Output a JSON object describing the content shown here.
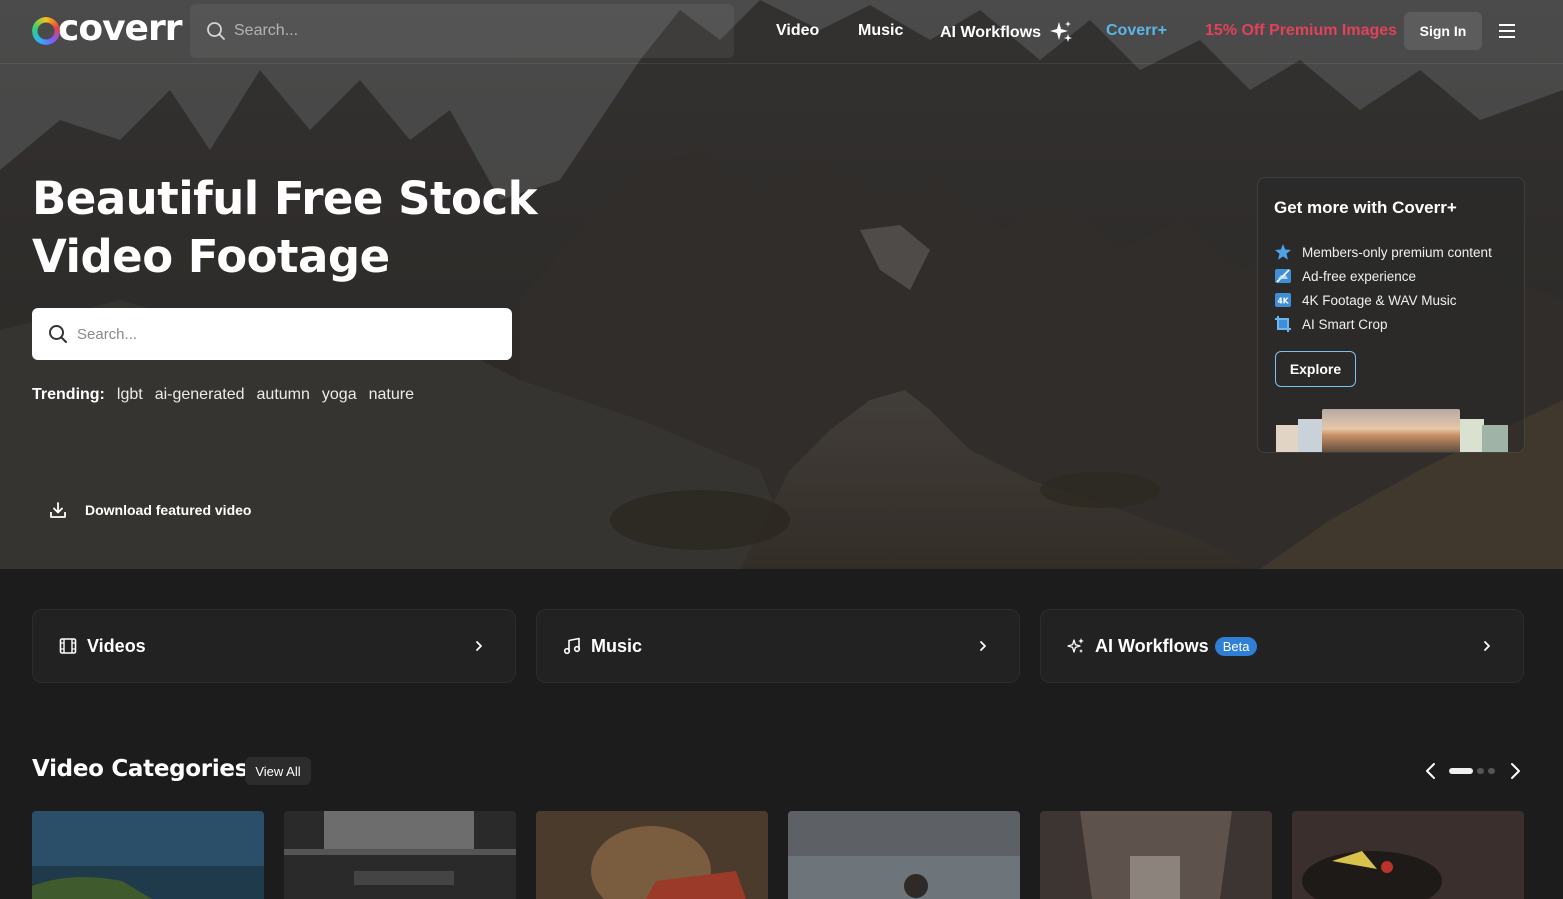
{
  "nav": {
    "logo_text": "coverr",
    "search_placeholder": "Search...",
    "links": {
      "video": "Video",
      "music": "Music",
      "ai_workflows": "AI Workflows",
      "coverr_plus": "Coverr+",
      "promo": "15% Off Premium Images"
    },
    "sign_in": "Sign In"
  },
  "hero": {
    "title": "Beautiful Free Stock Video Footage",
    "search_placeholder": "Search...",
    "trending_label": "Trending:",
    "trending": [
      "lgbt",
      "ai-generated",
      "autumn",
      "yoga",
      "nature"
    ],
    "download_label": "Download featured video"
  },
  "coverr_plus_panel": {
    "title": "Get more with Coverr+",
    "features": [
      {
        "icon": "star-icon",
        "label": "Members-only premium content"
      },
      {
        "icon": "ad-free-icon",
        "label": "Ad-free experience"
      },
      {
        "icon": "4k-icon",
        "label": "4K Footage & WAV Music"
      },
      {
        "icon": "crop-icon",
        "label": "AI Smart Crop"
      }
    ],
    "cta": "Explore"
  },
  "category_cards": [
    {
      "icon": "film-icon",
      "label": "Videos"
    },
    {
      "icon": "music-note-icon",
      "label": "Music"
    },
    {
      "icon": "sparkles-icon",
      "label": "AI Workflows",
      "badge": "Beta"
    }
  ],
  "video_categories": {
    "title": "Video Categories",
    "view_all": "View All",
    "carousel_pages": 3,
    "active_page": 1
  },
  "colors": {
    "accent_blue": "#5ab6e8",
    "promo_red": "#e0425a",
    "badge_blue": "#2f7fd6",
    "page_bg": "#1c1c1c"
  }
}
